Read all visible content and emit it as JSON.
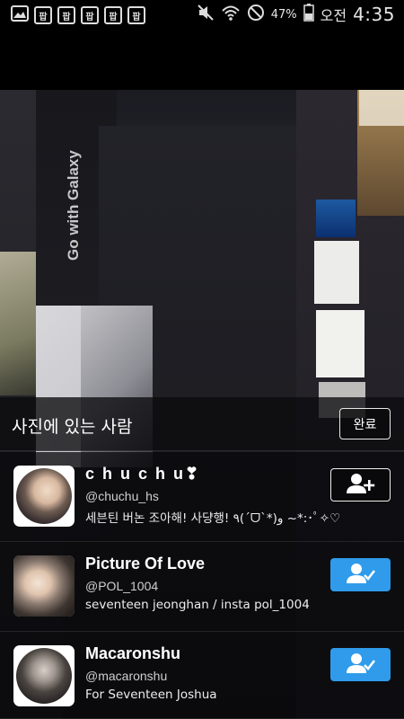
{
  "status_bar": {
    "notification_icons": [
      "팝",
      "팝",
      "팝",
      "팝",
      "팝"
    ],
    "battery_percent": "47%",
    "ampm": "오전",
    "time": "4:35"
  },
  "header": {
    "title": "사진에 있는 사람",
    "done_label": "완료"
  },
  "users": [
    {
      "name": "c h u c h u❣",
      "handle": "@chuchu_hs",
      "bio": "세븐틴 버논 조아해! 사댱행! ٩(ˊᗜˋ*)و ~*:･ﾟ✧♡",
      "following": false
    },
    {
      "name": "Picture Of Love",
      "handle": "@POL_1004",
      "bio": "seventeen jeonghan / insta pol_1004",
      "following": true
    },
    {
      "name": "Macaronshu",
      "handle": "@macaronshu",
      "bio": "For Seventeen Joshua",
      "following": true
    }
  ],
  "background_signs": {
    "go_with_galaxy": "Go with Galaxy"
  },
  "colors": {
    "following_blue": "#2f9bea"
  }
}
